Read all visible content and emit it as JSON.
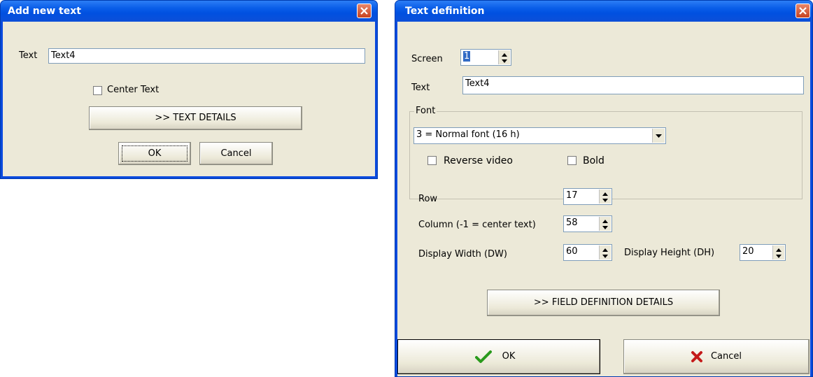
{
  "add_dialog": {
    "title": "Add new text",
    "text_label": "Text",
    "text_value": "Text4",
    "center_label": "Center Text",
    "details_button": ">> TEXT DETAILS",
    "ok_button": "OK",
    "cancel_button": "Cancel"
  },
  "def_dialog": {
    "title": "Text definition",
    "screen_label": "Screen",
    "screen_value": "1",
    "text_label": "Text",
    "text_value": "Text4",
    "font_group": "Font",
    "font_value": "3 = Normal font (16 h)",
    "reverse_label": "Reverse video",
    "bold_label": "Bold",
    "row_label": "Row",
    "row_value": "17",
    "column_label": "Column (-1 = center text)",
    "column_value": "58",
    "dw_label": "Display Width (DW)",
    "dw_value": "60",
    "dh_label": "Display Height (DH)",
    "dh_value": "20",
    "field_details_button": ">> FIELD DEFINITION DETAILS",
    "ok_button": "OK",
    "cancel_button": "Cancel"
  },
  "icons": {
    "close": "close-icon",
    "ok": "check-icon",
    "cancel": "x-icon"
  }
}
